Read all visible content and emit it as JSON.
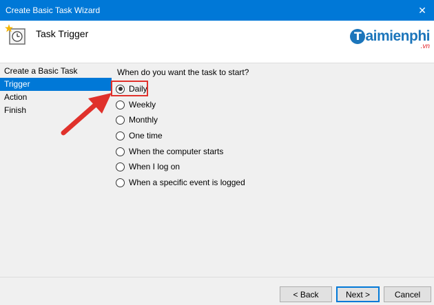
{
  "window": {
    "title": "Create Basic Task Wizard",
    "close_glyph": "✕"
  },
  "header": {
    "heading": "Task Trigger",
    "icon": "task-scheduler-clock-icon"
  },
  "watermark": {
    "mark": "T",
    "word": "aimienphi",
    "suffix": ".vn"
  },
  "sidebar": {
    "steps": [
      {
        "label": "Create a Basic Task",
        "active": false
      },
      {
        "label": "Trigger",
        "active": true
      },
      {
        "label": "Action",
        "active": false
      },
      {
        "label": "Finish",
        "active": false
      }
    ]
  },
  "main": {
    "question": "When do you want the task to start?",
    "options": [
      {
        "label": "Daily",
        "checked": true
      },
      {
        "label": "Weekly",
        "checked": false
      },
      {
        "label": "Monthly",
        "checked": false
      },
      {
        "label": "One time",
        "checked": false
      },
      {
        "label": "When the computer starts",
        "checked": false
      },
      {
        "label": "When I log on",
        "checked": false
      },
      {
        "label": "When a specific event is logged",
        "checked": false
      }
    ]
  },
  "buttons": {
    "back": "< Back",
    "next": "Next >",
    "cancel": "Cancel"
  },
  "colors": {
    "titlebar": "#0078d7",
    "selection": "#0078d7",
    "annotation": "#e0312b",
    "logo": "#1b75bb"
  }
}
